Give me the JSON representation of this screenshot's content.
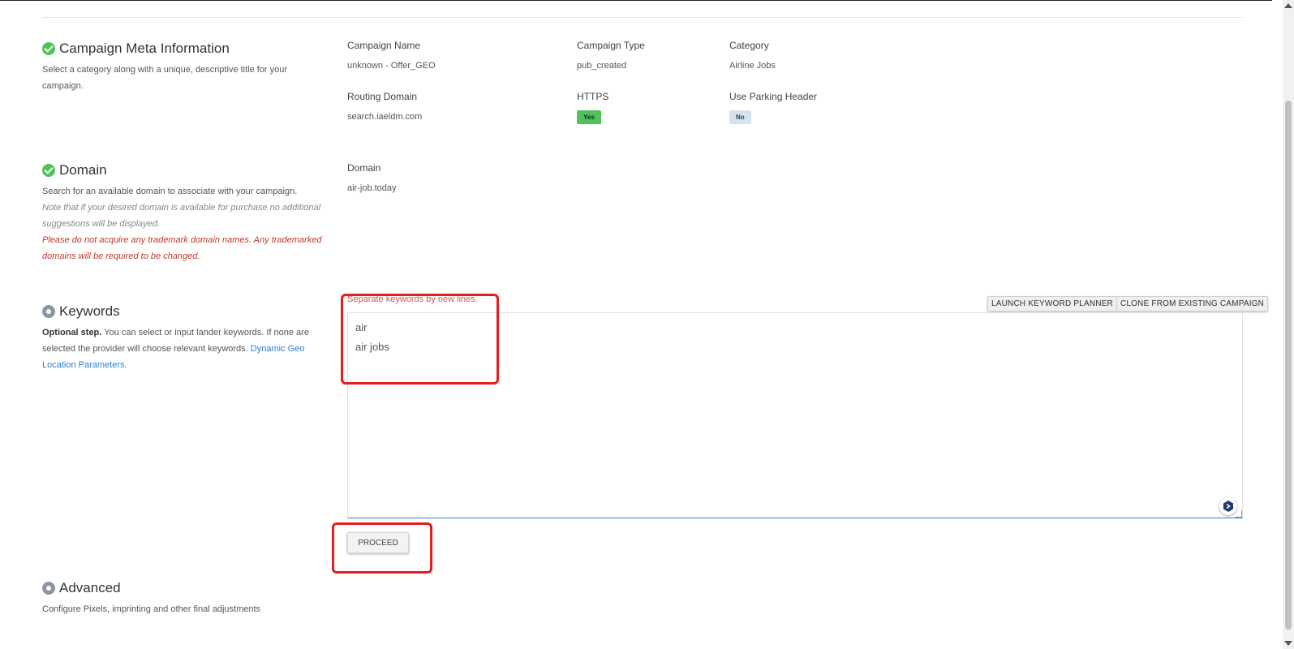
{
  "sections": {
    "meta": {
      "title": "Campaign Meta Information",
      "description": "Select a category along with a unique, descriptive title for your campaign.",
      "fields": {
        "campaign_name": {
          "label": "Campaign Name",
          "value": "unknown - Offer_GEO"
        },
        "campaign_type": {
          "label": "Campaign Type",
          "value": "pub_created"
        },
        "category": {
          "label": "Category",
          "value": "Airline Jobs"
        },
        "routing_domain": {
          "label": "Routing Domain",
          "value": "search.iaeldm.com"
        },
        "https": {
          "label": "HTTPS",
          "value": "Yes"
        },
        "parking_header": {
          "label": "Use Parking Header",
          "value": "No"
        }
      }
    },
    "domain": {
      "title": "Domain",
      "description": "Search for an available domain to associate with your campaign.",
      "note": "Note that if your desired domain is available for purchase no additional suggestions will be displayed.",
      "warning": "Please do not acquire any trademark domain names. Any trademarked domains will be required to be changed.",
      "field": {
        "label": "Domain",
        "value": "air-job.today"
      }
    },
    "keywords": {
      "title": "Keywords",
      "desc_strong": "Optional step.",
      "desc_text": " You can select or input lander keywords. If none are selected the provider will choose relevant keywords. ",
      "desc_link": "Dynamic Geo Location Parameters",
      "desc_end": ".",
      "hint": "Separate keywords by new lines.",
      "launch_planner": "LAUNCH KEYWORD PLANNER",
      "clone_existing": "CLONE FROM EXISTING CAMPAIGN",
      "textarea_value": "air\nair jobs",
      "proceed": "PROCEED"
    },
    "advanced": {
      "title": "Advanced",
      "description": "Configure Pixels, imprinting and other final adjustments"
    }
  },
  "colors": {
    "success": "#4fc25a",
    "pending": "#8c96a3",
    "warning": "#c0392b",
    "link": "#2e7fd1",
    "highlight": "#e21d1d"
  },
  "icons": {
    "done": "check-circle-icon",
    "pending": "radio-dot-icon",
    "widget": "assistant-widget-icon"
  }
}
